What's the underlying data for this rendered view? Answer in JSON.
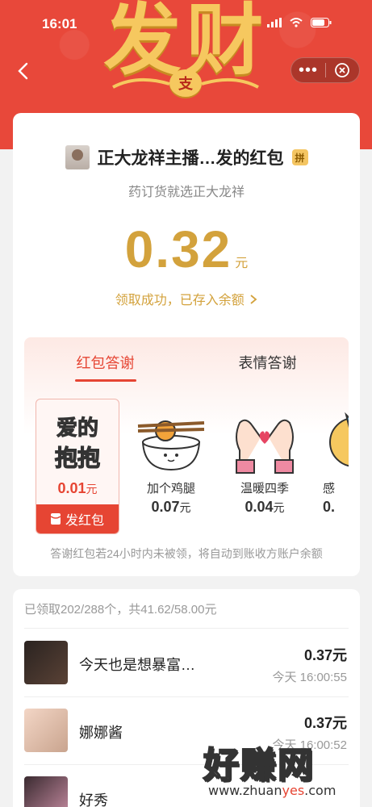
{
  "status": {
    "time": "16:01"
  },
  "banner": {
    "title": "发财",
    "badge": "支"
  },
  "card": {
    "sender_name": "正大龙祥主播…发的红包",
    "pin_badge": "拼",
    "greeting": "药订货就选正大龙祥",
    "amount": "0.32",
    "amount_unit": "元",
    "received_text": "领取成功，已存入余额",
    "tabs": [
      {
        "label": "红包答谢"
      },
      {
        "label": "表情答谢"
      }
    ],
    "stickers": [
      {
        "icon": "hug-sticker",
        "art_text": "爱的抱抱",
        "name": "",
        "price": "0.01",
        "unit": "元",
        "action": "发红包"
      },
      {
        "icon": "chicken-rice-sticker",
        "name": "加个鸡腿",
        "price": "0.07",
        "unit": "元"
      },
      {
        "icon": "heart-hands-sticker",
        "name": "温暖四季",
        "price": "0.04",
        "unit": "元"
      },
      {
        "icon": "thanks-sticker",
        "name": "感",
        "price": "0.",
        "unit": ""
      }
    ],
    "footnote": "答谢红包若24小时内未被领，将自动到账收方账户余额"
  },
  "list": {
    "summary": "已领取202/288个，共41.62/58.00元",
    "rows": [
      {
        "name": "今天也是想暴富…",
        "amount": "0.37元",
        "time": "今天 16:00:55"
      },
      {
        "name": "娜娜酱",
        "amount": "0.37元",
        "time": "今天 16:00:52"
      },
      {
        "name": "好秀",
        "amount": "",
        "time": ""
      }
    ]
  },
  "watermark": {
    "title": "好赚网",
    "url_pre": "www.zhuan",
    "url_hl": "yes",
    "url_post": ".com"
  },
  "colors": {
    "accent": "#e64533",
    "gold": "#d3a23c",
    "banner": "#e8483a"
  }
}
